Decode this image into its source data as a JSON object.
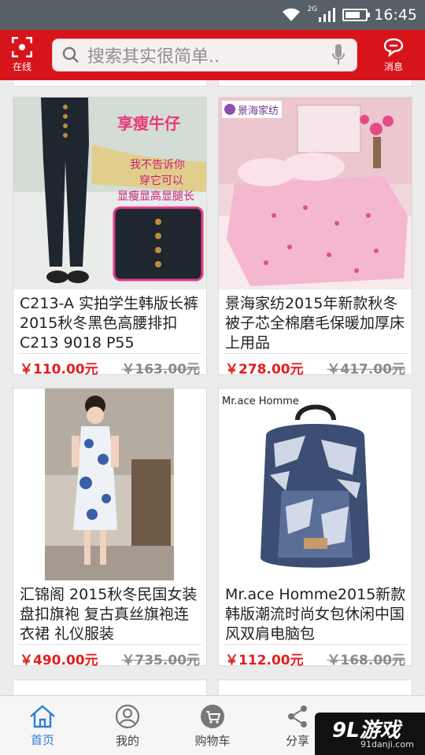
{
  "status": {
    "network": "2G",
    "time": "16:45",
    "battery_level": 0.6
  },
  "header": {
    "scan_label": "在线",
    "search_placeholder": "搜索其实很简单..",
    "message_label": "消息"
  },
  "products": [
    {
      "title": "C213-A 实拍学生韩版长裤2015秋冬黑色高腰排扣 C213 9018 P55",
      "price": "￥110.00元",
      "old_price": "￥163.00元",
      "image_text": [
        "享瘦牛仔",
        "我不告诉你",
        "穿它可以",
        "显瘦显高显腿长"
      ]
    },
    {
      "title": "景海家纺2015年新款秋冬被子芯全棉磨毛保暖加厚床上用品",
      "price": "￥278.00元",
      "old_price": "￥417.00元",
      "image_text": [
        "景海家纺"
      ]
    },
    {
      "title": "汇锦阁 2015秋冬民国女装 盘扣旗袍 复古真丝旗袍连衣裙 礼仪服装",
      "price": "￥490.00元",
      "old_price": "￥735.00元",
      "image_text": []
    },
    {
      "title": "Mr.ace Homme2015新款韩版潮流时尚女包休闲中国风双肩电脑包",
      "price": "￥112.00元",
      "old_price": "￥168.00元",
      "image_text": [
        "Mr.ace Homme"
      ]
    }
  ],
  "tabbar": {
    "tabs": [
      {
        "label": "首页"
      },
      {
        "label": "我的"
      },
      {
        "label": "购物车"
      },
      {
        "label": "分享"
      }
    ]
  },
  "watermark": {
    "brand": "9L游戏",
    "site": "91danji.com"
  },
  "colors": {
    "brand_red": "#d8141b",
    "price_red": "#e21d1d",
    "active_tab": "#2a7fd4"
  }
}
